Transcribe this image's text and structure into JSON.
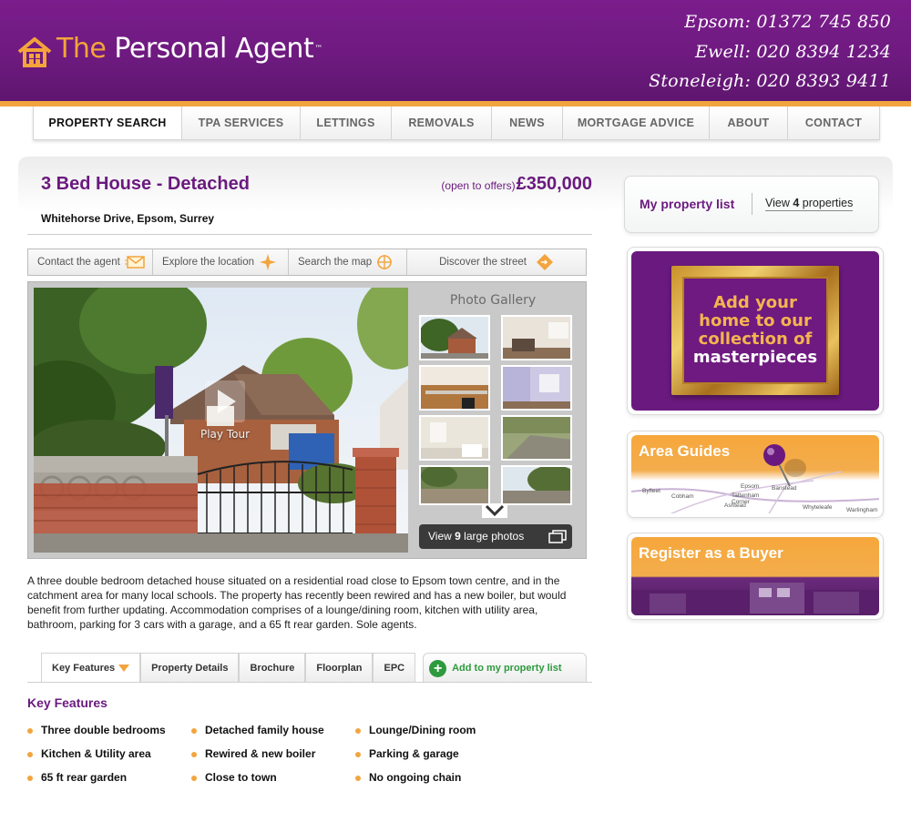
{
  "header": {
    "logo_the": "The",
    "logo_rest": "Personal Agent",
    "logo_tm": "™",
    "phones": [
      "Epsom: 01372 745 850",
      "Ewell: 020 8394 1234",
      "Stoneleigh: 020 8393 9411"
    ]
  },
  "nav": {
    "items": [
      {
        "label": "PROPERTY SEARCH"
      },
      {
        "label": "TPA SERVICES"
      },
      {
        "label": "LETTINGS"
      },
      {
        "label": "REMOVALS"
      },
      {
        "label": "NEWS"
      },
      {
        "label": "MORTGAGE ADVICE"
      },
      {
        "label": "ABOUT"
      },
      {
        "label": "CONTACT"
      }
    ]
  },
  "property": {
    "title": "3 Bed House - Detached",
    "price_qualifier": "(open to offers)",
    "price": "£350,000",
    "address": "Whitehorse Drive, Epsom, Surrey",
    "description": "A three double bedroom detached house situated on a residential road close to Epsom town centre, and in the catchment area for many local schools. The property has recently been rewired and has a new boiler, but would benefit from further updating. Accommodation comprises of a lounge/dining room, kitchen with utility area, bathroom, parking for 3 cars with a garage, and a 65 ft rear garden. Sole agents."
  },
  "actions": {
    "contact": "Contact the agent",
    "explore": "Explore the location",
    "map": "Search the map",
    "street": "Discover the street"
  },
  "gallery": {
    "title": "Photo Gallery",
    "play_label": "Play Tour",
    "view_prefix": "View",
    "view_count": "9",
    "view_suffix": "large photos"
  },
  "tabs": {
    "key_features": "Key Features",
    "property_details": "Property Details",
    "brochure": "Brochure",
    "floorplan": "Floorplan",
    "epc": "EPC",
    "add": "Add to my property list"
  },
  "key_features": {
    "heading": "Key Features",
    "items": [
      "Three double bedrooms",
      "Detached family house",
      "Lounge/Dining room",
      "Kitchen & Utility area",
      "Rewired & new boiler",
      "Parking & garage",
      "65 ft rear garden",
      "Close to town",
      "No ongoing chain"
    ]
  },
  "sidebar": {
    "plist_title": "My property list",
    "plist_view": "View",
    "plist_count": "4",
    "plist_suffix": "properties",
    "promo_lines": [
      "Add your",
      "home to our",
      "collection of",
      "masterpieces"
    ],
    "area_guides": "Area Guides",
    "map_labels": [
      "Byfleet",
      "Cobham",
      "Epsom",
      "Banstead",
      "Tattenham Corner",
      "Ashtead",
      "Whyteleafe",
      "Warlingham"
    ],
    "register_buyer": "Register as a Buyer"
  },
  "colors": {
    "brand_purple": "#6a1a7e",
    "accent_orange": "#f2a53f",
    "add_green": "#2d9a3d"
  }
}
